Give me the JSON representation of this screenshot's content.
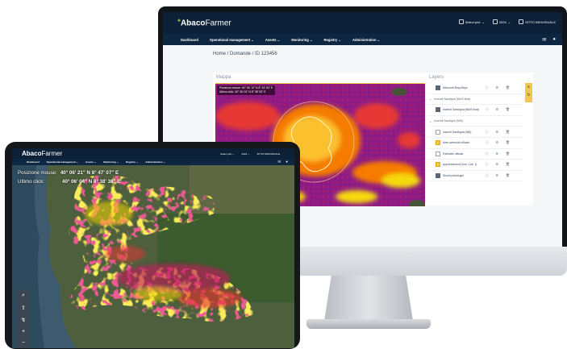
{
  "desktop": {
    "app": {
      "logo_bold": "Abaco",
      "logo_light": "Farmer"
    },
    "top_controls": [
      {
        "label": "Select plot",
        "icon": "chevron-down-icon"
      },
      {
        "label": "2024",
        "icon": "chevron-down-icon"
      },
      {
        "label": "SITTO INDIVIDUALE",
        "icon": "user-icon"
      }
    ],
    "nav": [
      "Dashboard",
      "Operational management ⌄",
      "Assets ⌄",
      "Monitoring ⌄",
      "Registry ⌄",
      "Administration ⌄"
    ],
    "breadcrumb": "Home  /  Domande  /  ID 123456",
    "map": {
      "title": "Mappa",
      "readout_mouse": "Posizione mouse:  40° 06' 12\" N 8° 43' 54\" E",
      "readout_click": "Ultimo click:        40° 06' 04\" N 8° 38' 05\" E"
    },
    "layers": {
      "title": "Layers",
      "rows": [
        {
          "label": "Microsoft Bing Maps",
          "type": "item",
          "checked": "on"
        },
        {
          "label": "Incendi Sardegna (BAIS float)",
          "type": "group"
        },
        {
          "label": "Incendi Sardegna (BAIS float)",
          "type": "item",
          "checked": "on"
        },
        {
          "label": "Incendi Sardegna (NBI)",
          "type": "group"
        },
        {
          "label": "Incendi Sardegna (NBI)",
          "type": "item",
          "checked": "off"
        },
        {
          "label": "Aree aziendali ufficiali",
          "type": "item",
          "checked": "warn"
        },
        {
          "label": "Particelle ufficiali",
          "type": "item",
          "checked": "off"
        },
        {
          "label": "Appezzamenti (Ann. Colt. 1)",
          "type": "item",
          "checked": "warn"
        },
        {
          "label": "Sfondi pedologici",
          "type": "item",
          "checked": "on"
        }
      ]
    }
  },
  "tablet": {
    "app": {
      "logo_bold": "Abaco",
      "logo_light": "Farmer"
    },
    "top_controls": [
      "Select plot ⌄",
      "2024 ⌄",
      "SITTO INDIVIDUALE"
    ],
    "nav": [
      "Dashboard",
      "Operational management ⌄",
      "Assets ⌄",
      "Monitoring ⌄",
      "Registry ⌄",
      "Administration ⌄"
    ],
    "readout": {
      "mouse_label": "Posizione mouse:",
      "mouse_value": "40° 06' 21\" N 8° 47' 07\" E",
      "click_label": "Ultimo click:",
      "click_value": "40° 06' 04\" N 8° 38' 38\" E"
    },
    "tools": [
      "search-icon",
      "upload-icon",
      "route-icon",
      "plus-icon",
      "minus-icon"
    ]
  },
  "colors": {
    "navy": "#0c2038",
    "accent": "#f2c94c",
    "burn_high": "#c2185b",
    "burn_mid": "#e53935",
    "burn_low": "#f5d90a"
  }
}
